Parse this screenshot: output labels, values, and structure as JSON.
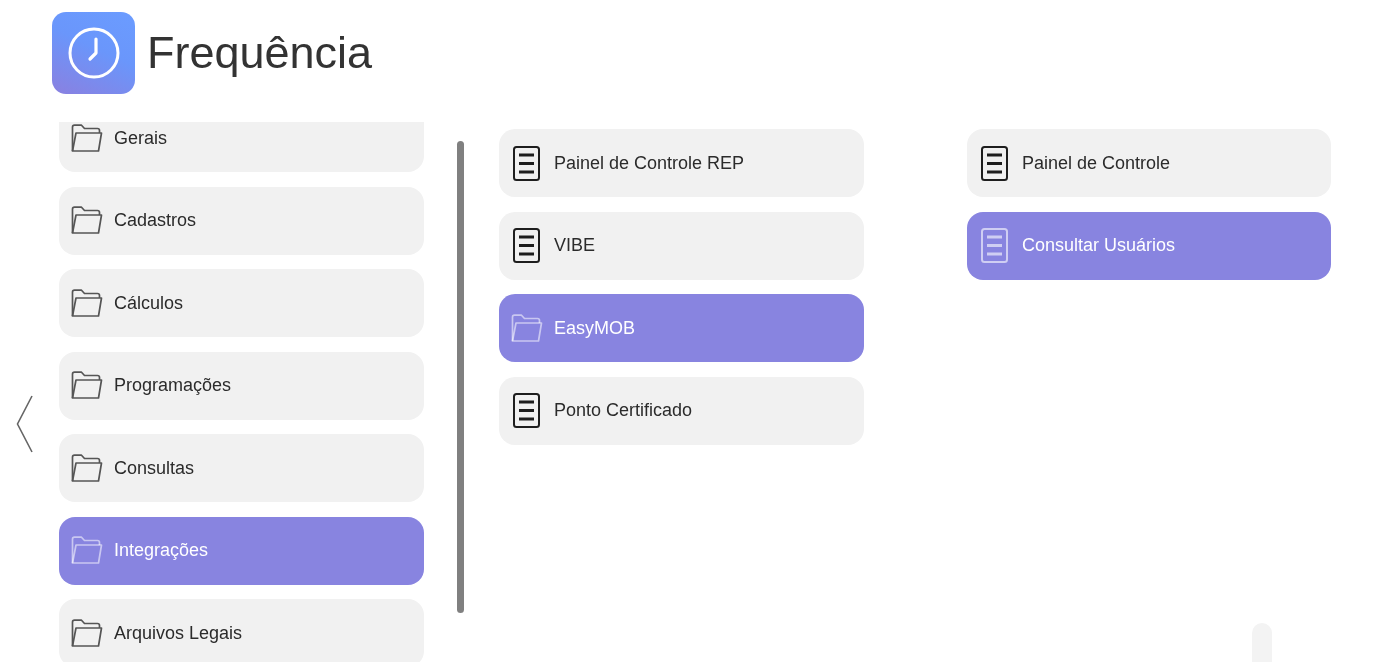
{
  "app": {
    "title": "Frequência"
  },
  "columns": [
    {
      "items": [
        {
          "kind": "folder",
          "label": "Gerais",
          "selected": false
        },
        {
          "kind": "folder",
          "label": "Cadastros",
          "selected": false
        },
        {
          "kind": "folder",
          "label": "Cálculos",
          "selected": false
        },
        {
          "kind": "folder",
          "label": "Programações",
          "selected": false
        },
        {
          "kind": "folder",
          "label": "Consultas",
          "selected": false
        },
        {
          "kind": "folder",
          "label": "Integrações",
          "selected": true
        },
        {
          "kind": "folder",
          "label": "Arquivos Legais",
          "selected": false
        }
      ]
    },
    {
      "items": [
        {
          "kind": "document",
          "label": "Painel de Controle REP",
          "selected": false
        },
        {
          "kind": "document",
          "label": "VIBE",
          "selected": false
        },
        {
          "kind": "folder",
          "label": "EasyMOB",
          "selected": true
        },
        {
          "kind": "document",
          "label": "Ponto Certificado",
          "selected": false
        }
      ]
    },
    {
      "items": [
        {
          "kind": "document",
          "label": "Painel de Controle",
          "selected": false
        },
        {
          "kind": "document",
          "label": "Consultar Usuários",
          "selected": true
        }
      ]
    }
  ]
}
